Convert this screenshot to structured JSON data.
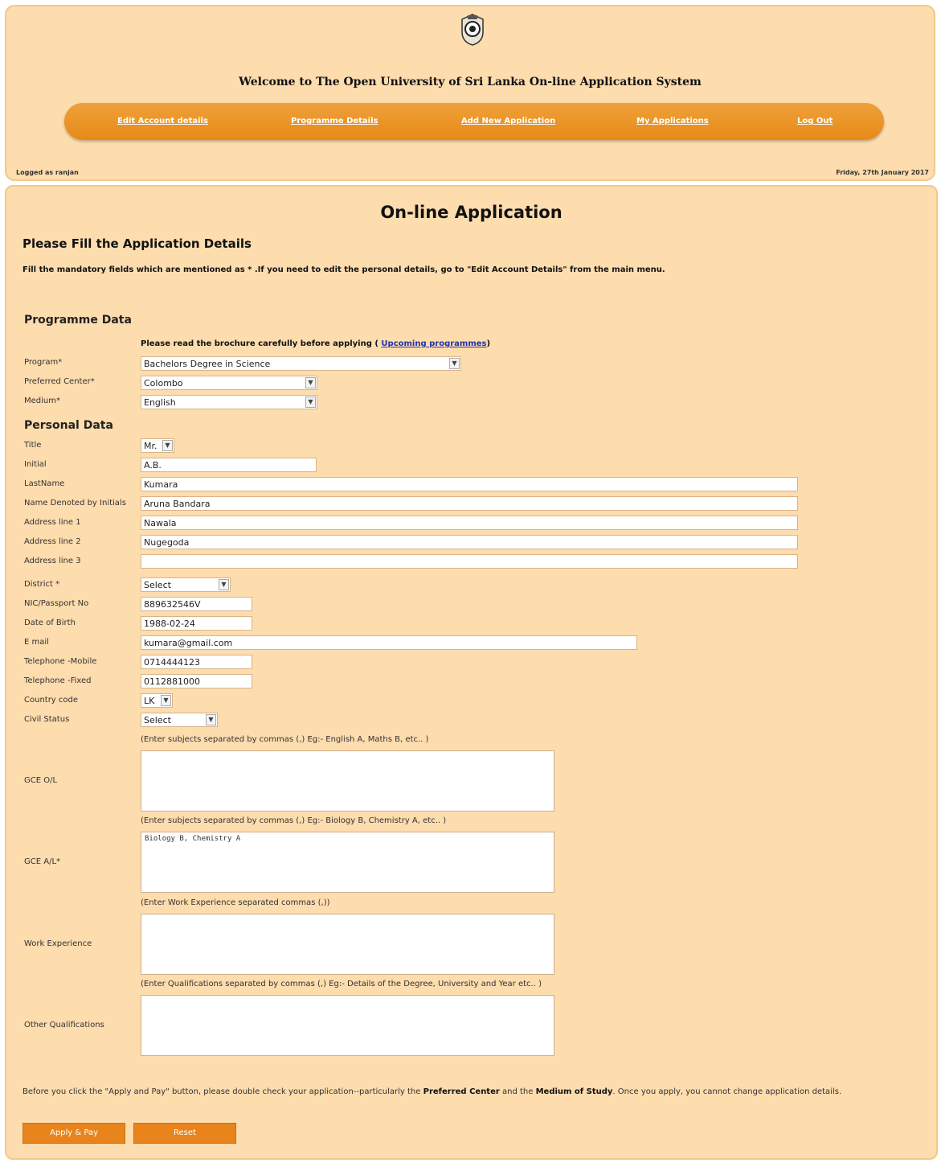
{
  "header": {
    "logo": "university-crest",
    "welcome": "Welcome to The Open University of Sri Lanka On-line Application System",
    "nav": [
      "Edit Account details",
      "Programme Details",
      "Add New Application",
      "My Applications",
      "Log Out"
    ],
    "logged_as": "Logged as ranjan",
    "date": "Friday, 27th January 2017"
  },
  "main": {
    "title": "On-line Application",
    "subtitle": "Please Fill the Application Details",
    "instruction": "Fill the mandatory fields which are mentioned as * .If you need to edit the personal details, go to \"Edit Account Details\" from the main menu.",
    "section_programme": "Programme Data",
    "brochure_prefix": "Please read the brochure carefully before applying (",
    "brochure_link": "Upcoming programmes",
    "brochure_suffix": ")",
    "section_personal": "Personal Data"
  },
  "fields": {
    "program": {
      "label": "Program*",
      "value": "Bachelors Degree in Science"
    },
    "center": {
      "label": "Preferred Center*",
      "value": "Colombo"
    },
    "medium": {
      "label": "Medium*",
      "value": "English"
    },
    "title": {
      "label": "Title",
      "value": "Mr."
    },
    "initial": {
      "label": "Initial",
      "value": "A.B."
    },
    "lastname": {
      "label": "LastName",
      "value": "Kumara"
    },
    "initials_name": {
      "label": "Name Denoted by Initials",
      "value": "Aruna Bandara"
    },
    "address1": {
      "label": "Address line 1",
      "value": "Nawala"
    },
    "address2": {
      "label": "Address line 2",
      "value": "Nugegoda"
    },
    "address3": {
      "label": "Address line 3",
      "value": ""
    },
    "district": {
      "label": "District *",
      "value": "Select"
    },
    "nic": {
      "label": "NIC/Passport No",
      "value": "889632546V"
    },
    "dob": {
      "label": "Date of Birth",
      "value": "1988-02-24"
    },
    "email": {
      "label": "E mail",
      "value": "kumara@gmail.com"
    },
    "mobile": {
      "label": "Telephone -Mobile",
      "value": "0714444123"
    },
    "fixed": {
      "label": "Telephone -Fixed",
      "value": "0112881000"
    },
    "country": {
      "label": "Country code",
      "value": "LK"
    },
    "civil": {
      "label": "Civil Status",
      "value": "Select"
    },
    "gce_ol": {
      "label": "GCE O/L",
      "hint": "(Enter subjects separated by commas (,) Eg:- English A, Maths B, etc.. )",
      "value": ""
    },
    "gce_al": {
      "label": "GCE A/L*",
      "hint": "(Enter subjects separated by commas (,) Eg:- Biology B, Chemistry A, etc.. )",
      "value": "Biology B, Chemistry A"
    },
    "work": {
      "label": "Work Experience",
      "hint": "(Enter Work Experience separated commas (,))",
      "value": ""
    },
    "other": {
      "label": "Other Qualifications",
      "hint": "(Enter Qualifications separated by commas (,) Eg:- Details of the Degree, University and Year etc.. )",
      "value": ""
    }
  },
  "note": {
    "part1": "Before you click the \"Apply and Pay\" button, please double check your application--particularly the",
    "bold1": "Preferred Center",
    "part2": "and the",
    "bold2": "Medium of Study",
    "part3": ". Once you apply, you cannot change application details."
  },
  "buttons": {
    "apply": "Apply & Pay",
    "reset": "Reset"
  },
  "colors": {
    "background": "#fddcae",
    "accent": "#e8841b",
    "link": "#2233aa"
  }
}
